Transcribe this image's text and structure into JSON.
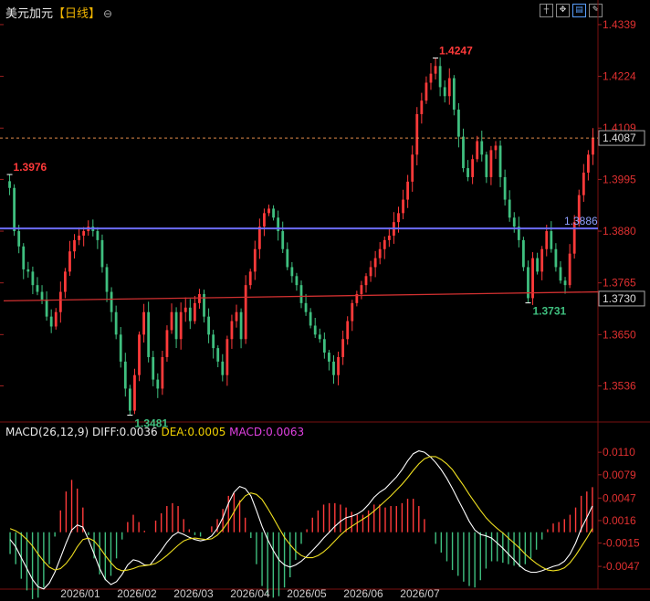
{
  "header": {
    "symbol": "美元加元",
    "period": "【日线】",
    "toggle_icon": "circle-minus-icon"
  },
  "toolbar": {
    "icons": [
      "crosshair-icon",
      "move-icon",
      "chart-mode-icon",
      "drawing-icon"
    ]
  },
  "chart_data": [
    {
      "type": "candlestick",
      "ylim": [
        1.347,
        1.4345
      ],
      "y_ticks": [
        "1.4339",
        "1.4224",
        "1.4109",
        "1.3995",
        "1.3880",
        "1.3765",
        "1.3650",
        "1.3536"
      ],
      "x_ticks": [
        "2026/01",
        "2026/02",
        "2026/03",
        "2026/04",
        "2026/05",
        "2026/06",
        "2026/07"
      ],
      "current_price": "1.4087",
      "blue_line_label": "1.3886",
      "red_line_label": "1.3730",
      "annotations": [
        {
          "label": "1.3976",
          "kind": "high"
        },
        {
          "label": "1.3481",
          "kind": "low"
        },
        {
          "label": "1.4247",
          "kind": "high"
        },
        {
          "label": "1.3731",
          "kind": "low"
        }
      ],
      "colors": {
        "up": "#ff3a3a",
        "down": "#3fbf7f",
        "blue_line": "#6b6bff",
        "red_line": "#d03030",
        "last_line": "#e08a4a"
      },
      "closes": [
        1.3976,
        1.388,
        1.3846,
        1.3795,
        1.379,
        1.376,
        1.3745,
        1.3728,
        1.369,
        1.3668,
        1.37,
        1.3745,
        1.379,
        1.3835,
        1.386,
        1.387,
        1.388,
        1.389,
        1.388,
        1.386,
        1.38,
        1.3745,
        1.37,
        1.365,
        1.359,
        1.353,
        1.3481,
        1.356,
        1.365,
        1.37,
        1.36,
        1.355,
        1.353,
        1.36,
        1.366,
        1.37,
        1.364,
        1.37,
        1.371,
        1.368,
        1.372,
        1.374,
        1.369,
        1.365,
        1.362,
        1.359,
        1.356,
        1.364,
        1.368,
        1.37,
        1.364,
        1.376,
        1.379,
        1.384,
        1.389,
        1.392,
        1.393,
        1.391,
        1.388,
        1.384,
        1.38,
        1.378,
        1.376,
        1.372,
        1.37,
        1.367,
        1.365,
        1.364,
        1.361,
        1.359,
        1.356,
        1.36,
        1.364,
        1.368,
        1.372,
        1.374,
        1.376,
        1.378,
        1.38,
        1.382,
        1.384,
        1.386,
        1.387,
        1.39,
        1.392,
        1.395,
        1.399,
        1.405,
        1.414,
        1.417,
        1.421,
        1.423,
        1.4247,
        1.42,
        1.418,
        1.422,
        1.415,
        1.409,
        1.402,
        1.4,
        1.404,
        1.408,
        1.405,
        1.4,
        1.406,
        1.407,
        1.4,
        1.395,
        1.391,
        1.389,
        1.386,
        1.38,
        1.3731,
        1.382,
        1.379,
        1.384,
        1.388,
        1.384,
        1.38,
        1.377,
        1.376,
        1.383,
        1.39,
        1.396,
        1.401,
        1.405,
        1.4087
      ],
      "macd": {
        "params": "MACD(26,12,9)",
        "diff_label": "DIFF:0.0036",
        "dea_label": "DEA:0.0005",
        "macd_label": "MACD:0.0063",
        "ylim": [
          -0.0072,
          0.0124
        ],
        "y_ticks": [
          "0.0110",
          "0.0079",
          "0.0047",
          "0.0016",
          "-0.0015",
          "-0.0047"
        ],
        "diff": [
          -0.001,
          -0.002,
          -0.0035,
          -0.005,
          -0.0065,
          -0.0075,
          -0.0078,
          -0.007,
          -0.0055,
          -0.0035,
          -0.0015,
          0.0003,
          0.001,
          0.0007,
          -0.001,
          -0.003,
          -0.005,
          -0.0065,
          -0.0072,
          -0.0068,
          -0.0058,
          -0.0045,
          -0.0038,
          -0.004,
          -0.0045,
          -0.0045,
          -0.0035,
          -0.0025,
          -0.0014,
          -0.0005,
          0.0,
          -0.0003,
          -0.0007,
          -0.001,
          -0.0012,
          -0.001,
          -0.0005,
          0.0005,
          0.002,
          0.004,
          0.0055,
          0.0063,
          0.006,
          0.005,
          0.003,
          0.0008,
          -0.001,
          -0.0025,
          -0.0038,
          -0.0045,
          -0.0048,
          -0.0045,
          -0.004,
          -0.0033,
          -0.0025,
          -0.0017,
          -0.0008,
          0.0,
          0.0008,
          0.0015,
          0.002,
          0.0022,
          0.0025,
          0.003,
          0.0038,
          0.0048,
          0.0055,
          0.006,
          0.0068,
          0.0076,
          0.0086,
          0.0098,
          0.0108,
          0.0112,
          0.011,
          0.0104,
          0.0096,
          0.0086,
          0.0074,
          0.006,
          0.0045,
          0.003,
          0.0015,
          0.0003,
          -0.0003,
          -0.0005,
          -0.0008,
          -0.0015,
          -0.0022,
          -0.003,
          -0.0038,
          -0.0046,
          -0.0052,
          -0.0055,
          -0.0055,
          -0.0053,
          -0.005,
          -0.0047,
          -0.0045,
          -0.004,
          -0.003,
          -0.0015,
          0.0005,
          0.002,
          0.0036
        ],
        "dea": [
          0.0005,
          0.0002,
          -0.0003,
          -0.001,
          -0.0019,
          -0.003,
          -0.004,
          -0.0048,
          -0.0052,
          -0.005,
          -0.0043,
          -0.0033,
          -0.002,
          -0.001,
          -0.0008,
          -0.0012,
          -0.0021,
          -0.0032,
          -0.0042,
          -0.005,
          -0.0053,
          -0.0052,
          -0.005,
          -0.0047,
          -0.0046,
          -0.0045,
          -0.0043,
          -0.0038,
          -0.0032,
          -0.0025,
          -0.0018,
          -0.0012,
          -0.0009,
          -0.0008,
          -0.0009,
          -0.001,
          -0.0009,
          -0.0004,
          0.0004,
          0.0015,
          0.0028,
          0.0041,
          0.005,
          0.0054,
          0.0052,
          0.0045,
          0.0033,
          0.002,
          0.0006,
          -0.0007,
          -0.0017,
          -0.0026,
          -0.0032,
          -0.0035,
          -0.0035,
          -0.0032,
          -0.0027,
          -0.002,
          -0.0012,
          -0.0004,
          0.0003,
          0.0008,
          0.0013,
          0.0018,
          0.0023,
          0.0029,
          0.0036,
          0.0043,
          0.005,
          0.0058,
          0.0066,
          0.0075,
          0.0085,
          0.0094,
          0.0101,
          0.0104,
          0.0104,
          0.01,
          0.0094,
          0.0086,
          0.0075,
          0.0064,
          0.0052,
          0.0041,
          0.003,
          0.002,
          0.0012,
          0.0005,
          -0.0001,
          -0.0008,
          -0.0015,
          -0.0022,
          -0.003,
          -0.0037,
          -0.0043,
          -0.0048,
          -0.0052,
          -0.0053,
          -0.0052,
          -0.0049,
          -0.0042,
          -0.0032,
          -0.002,
          -0.0008,
          0.0005
        ]
      }
    }
  ]
}
